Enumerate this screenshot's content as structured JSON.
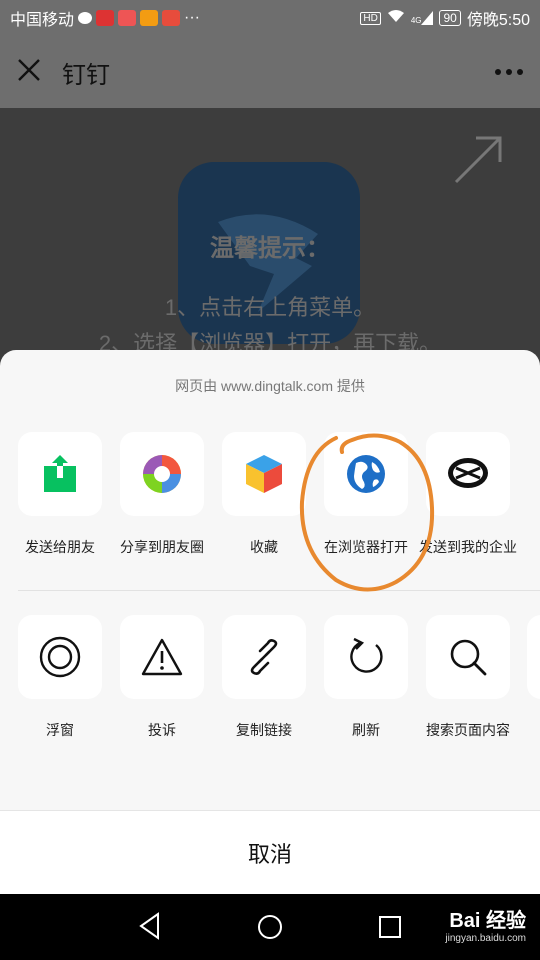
{
  "status_bar": {
    "carrier": "中国移动",
    "dots": "···",
    "hd": "HD",
    "signal": "4G",
    "battery": "90",
    "time": "傍晚5:50"
  },
  "title_bar": {
    "title": "钉钉"
  },
  "webview": {
    "tip_title": "温馨提示：",
    "tip_line_1": "1、点击右上角菜单。",
    "tip_line_2": "2、选择【浏览器】打开，再下载。"
  },
  "share_sheet": {
    "provider_text": "网页由 www.dingtalk.com 提供",
    "row1": [
      {
        "label": "发送给朋友",
        "icon": "share-to-friend-icon"
      },
      {
        "label": "分享到朋友圈",
        "icon": "moments-icon"
      },
      {
        "label": "收藏",
        "icon": "favorite-cube-icon"
      },
      {
        "label": "在浏览器打开",
        "icon": "globe-icon"
      },
      {
        "label": "发送到我的企业",
        "icon": "work-wechat-icon"
      }
    ],
    "row2": [
      {
        "label": "浮窗",
        "icon": "float-window-icon"
      },
      {
        "label": "投诉",
        "icon": "warning-icon"
      },
      {
        "label": "复制链接",
        "icon": "link-icon"
      },
      {
        "label": "刷新",
        "icon": "refresh-icon"
      },
      {
        "label": "搜索页面内容",
        "icon": "search-icon"
      }
    ],
    "cancel_label": "取消"
  },
  "watermark": {
    "main": "Bai 经验",
    "sub": "jingyan.baidu.com"
  },
  "colors": {
    "annotation": "#e8892f",
    "wechat_green": "#07c160",
    "globe_blue": "#1e6fc7"
  }
}
